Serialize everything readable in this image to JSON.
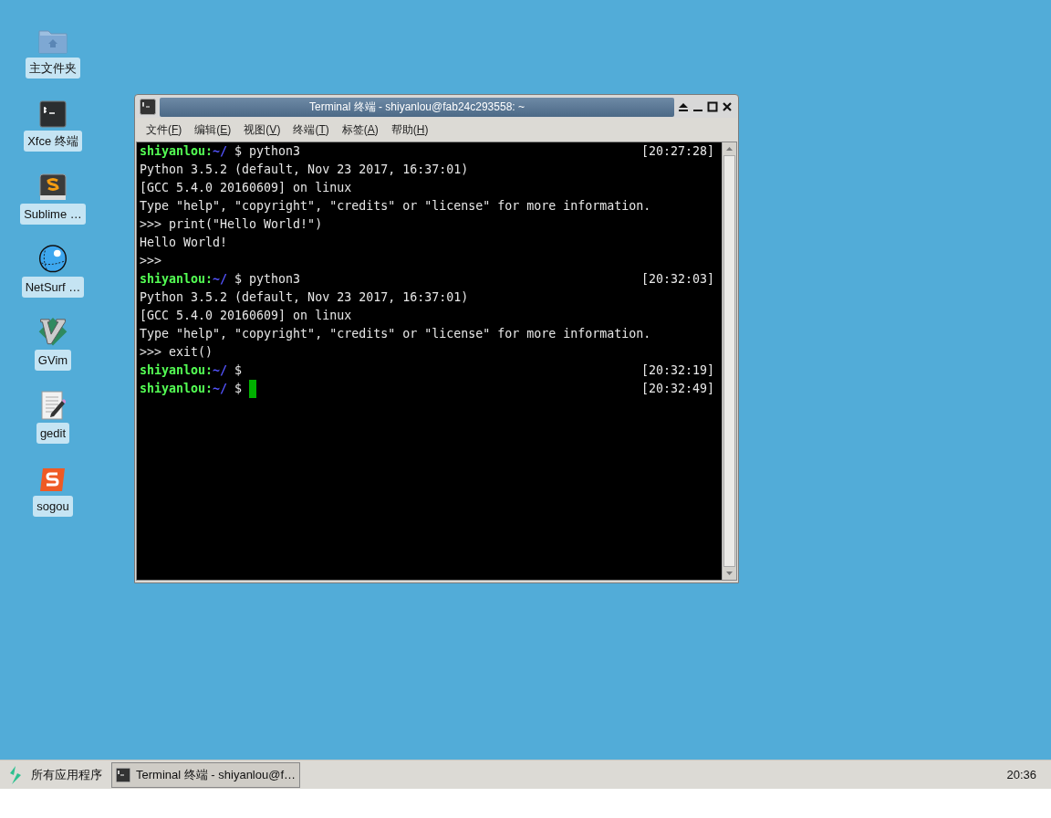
{
  "desktop_icons": [
    {
      "kind": "folder",
      "label": "主文件夹"
    },
    {
      "kind": "terminal",
      "label": "Xfce 终端"
    },
    {
      "kind": "sublime",
      "label": "Sublime …"
    },
    {
      "kind": "globe",
      "label": "NetSurf …"
    },
    {
      "kind": "vim",
      "label": "GVim"
    },
    {
      "kind": "editor",
      "label": "gedit"
    },
    {
      "kind": "sogou",
      "label": "sogou"
    }
  ],
  "window": {
    "title": "Terminal 终端 - shiyanlou@fab24c293558: ~",
    "menu": [
      {
        "prefix": "文件(",
        "key": "F",
        "suffix": ")"
      },
      {
        "prefix": "编辑(",
        "key": "E",
        "suffix": ")"
      },
      {
        "prefix": "视图(",
        "key": "V",
        "suffix": ")"
      },
      {
        "prefix": "终端(",
        "key": "T",
        "suffix": ")"
      },
      {
        "prefix": "标签(",
        "key": "A",
        "suffix": ")"
      },
      {
        "prefix": "帮助(",
        "key": "H",
        "suffix": ")"
      }
    ],
    "lines": [
      {
        "kind": "prompt",
        "user": "shiyanlou:",
        "path": "~/",
        "command": "$ python3",
        "time": "[20:27:28]",
        "cursor": false
      },
      {
        "kind": "output",
        "text": "Python 3.5.2 (default, Nov 23 2017, 16:37:01)"
      },
      {
        "kind": "output",
        "text": "[GCC 5.4.0 20160609] on linux"
      },
      {
        "kind": "output",
        "text": "Type \"help\", \"copyright\", \"credits\" or \"license\" for more information."
      },
      {
        "kind": "output",
        "text": ">>> print(\"Hello World!\")"
      },
      {
        "kind": "output",
        "text": "Hello World!"
      },
      {
        "kind": "output",
        "text": ">>>"
      },
      {
        "kind": "prompt",
        "user": "shiyanlou:",
        "path": "~/",
        "command": "$ python3",
        "time": "[20:32:03]",
        "cursor": false
      },
      {
        "kind": "output",
        "text": "Python 3.5.2 (default, Nov 23 2017, 16:37:01)"
      },
      {
        "kind": "output",
        "text": "[GCC 5.4.0 20160609] on linux"
      },
      {
        "kind": "output",
        "text": "Type \"help\", \"copyright\", \"credits\" or \"license\" for more information."
      },
      {
        "kind": "output",
        "text": ">>> exit()"
      },
      {
        "kind": "prompt",
        "user": "shiyanlou:",
        "path": "~/",
        "command": "$",
        "time": "[20:32:19]",
        "cursor": false
      },
      {
        "kind": "prompt",
        "user": "shiyanlou:",
        "path": "~/",
        "command": "$",
        "time": "[20:32:49]",
        "cursor": true
      }
    ]
  },
  "taskbar": {
    "apps_menu": "所有应用程序",
    "tasks": [
      {
        "label": "Terminal 终端 - shiyanlou@f…",
        "selected": true
      }
    ],
    "clock": "20:36"
  }
}
